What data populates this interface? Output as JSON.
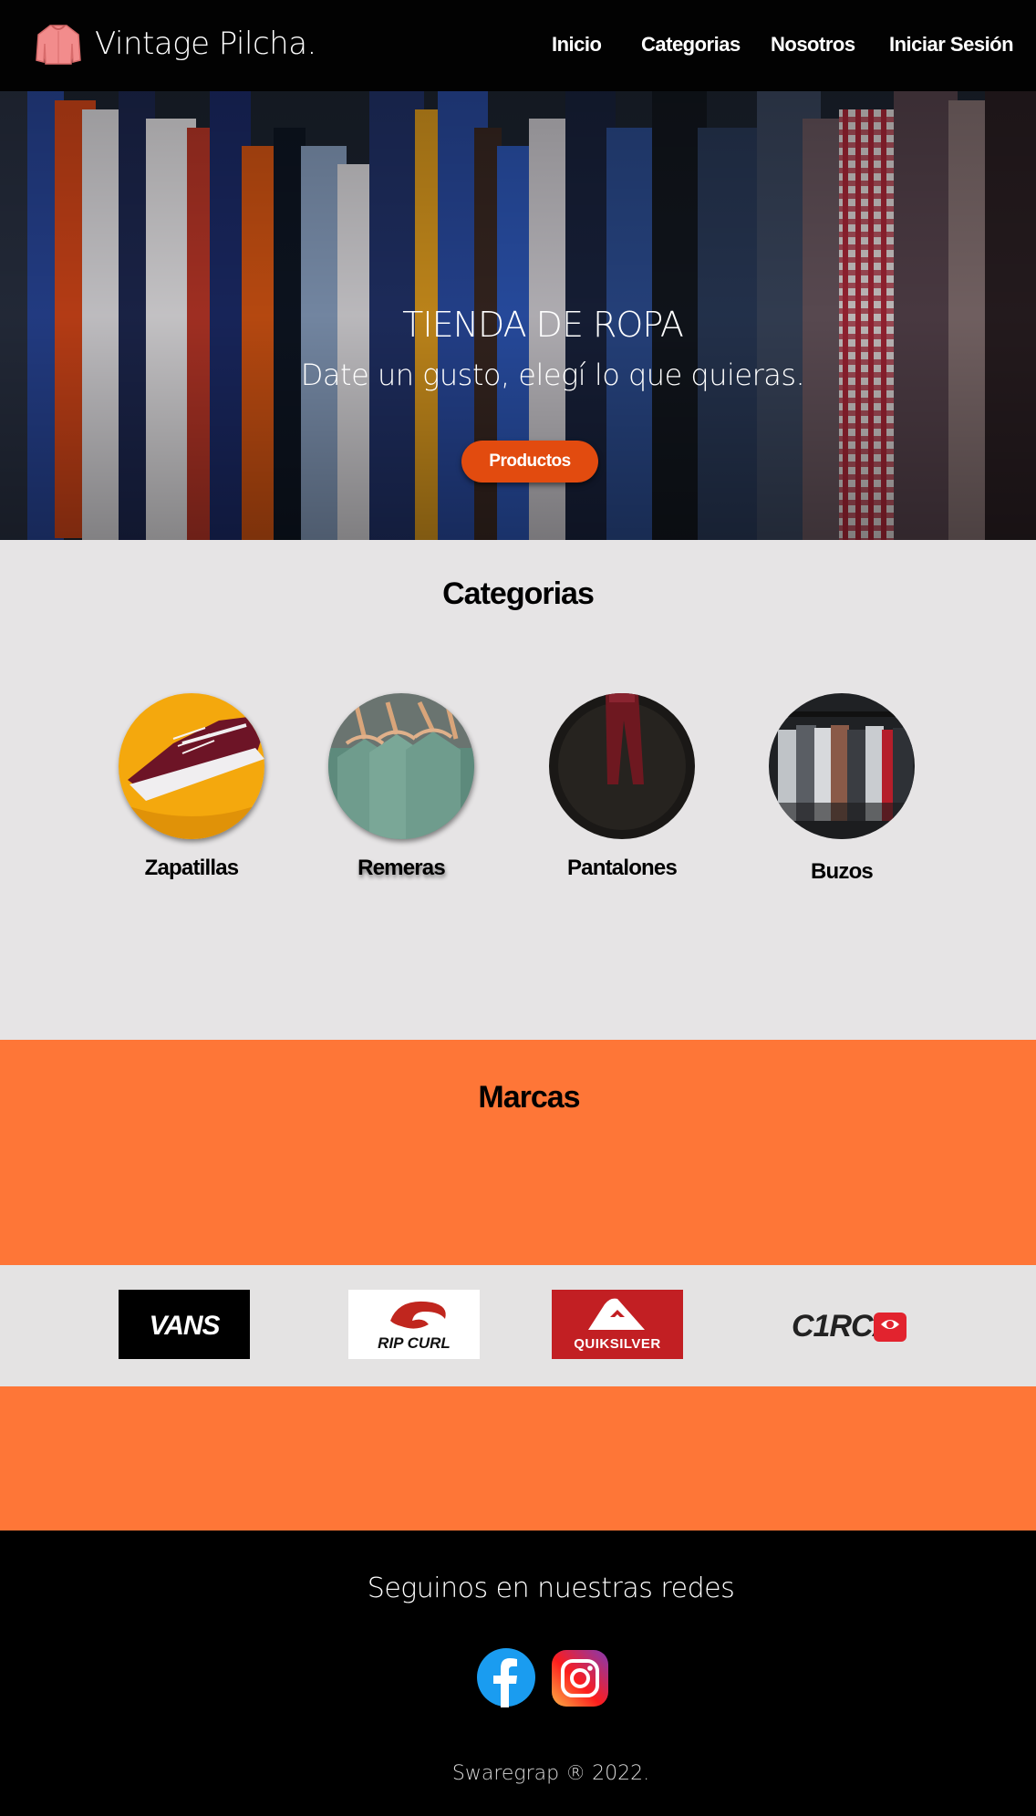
{
  "nav": {
    "brand": "Vintage Pilcha.",
    "logo_icon": "sweater-icon",
    "links": [
      "Inicio",
      "Categorias",
      "Nosotros",
      "Iniciar Sesión"
    ]
  },
  "hero": {
    "title": "TIENDA DE ROPA",
    "subtitle": "Date un gusto, elegí lo que quieras.",
    "button": "Productos"
  },
  "categories": {
    "title": "Categorias",
    "items": [
      {
        "label": "Zapatillas",
        "image": "sneaker-photo"
      },
      {
        "label": "Remeras",
        "image": "tshirts-photo"
      },
      {
        "label": "Pantalones",
        "image": "pants-photo"
      },
      {
        "label": "Buzos",
        "image": "hoodies-photo"
      }
    ]
  },
  "brands": {
    "title": "Marcas",
    "items": [
      {
        "name": "VANS",
        "label": "VANS"
      },
      {
        "name": "RIP CURL",
        "label": "RIP CURL"
      },
      {
        "name": "QUIKSILVER",
        "label": "QUIKSILVER"
      },
      {
        "name": "CIRCA",
        "label": "C1RCA"
      }
    ]
  },
  "footer": {
    "follow": "Seguinos en nuestras redes",
    "social": [
      "facebook-icon",
      "instagram-icon"
    ],
    "copyright": "Swaregrap  ®  2022."
  },
  "colors": {
    "accent": "#fe7637",
    "button": "#e24b0f",
    "light_bg": "#e6e4e5",
    "dark": "#000000"
  }
}
